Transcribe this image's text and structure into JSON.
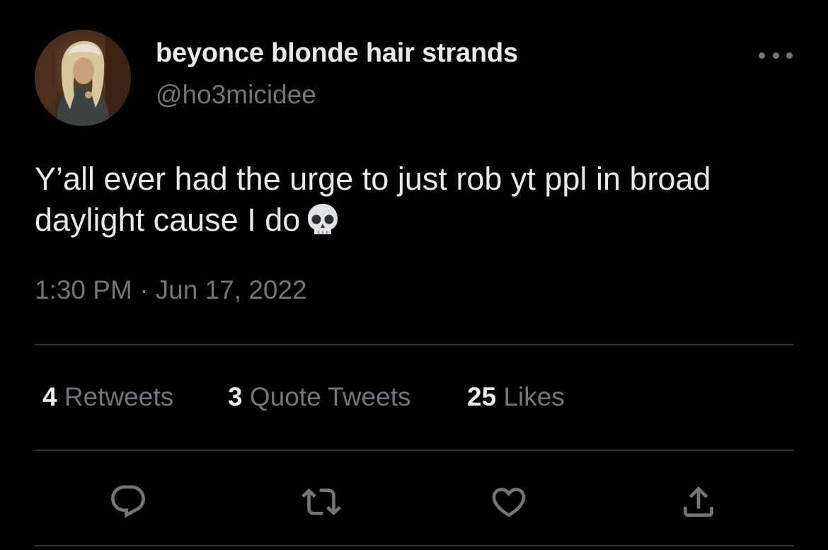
{
  "author": {
    "display_name": "beyonce blonde hair strands",
    "handle": "@ho3micidee"
  },
  "tweet": {
    "text_line1": "Y’all ever had the urge to just rob yt ppl in broad",
    "text_line2": "daylight cause I do",
    "emoji": "skull-icon",
    "timestamp": "1:30 PM · Jun 17, 2022"
  },
  "stats": {
    "retweets_count": "4",
    "retweets_label": "Retweets",
    "quotes_count": "3",
    "quotes_label": "Quote Tweets",
    "likes_count": "25",
    "likes_label": "Likes"
  },
  "actions": [
    "reply-icon",
    "retweet-icon",
    "like-icon",
    "share-icon"
  ],
  "colors": {
    "background": "#000000",
    "primary_text": "#e7e9ea",
    "secondary_text": "#71767b",
    "divider": "#2f3336"
  }
}
